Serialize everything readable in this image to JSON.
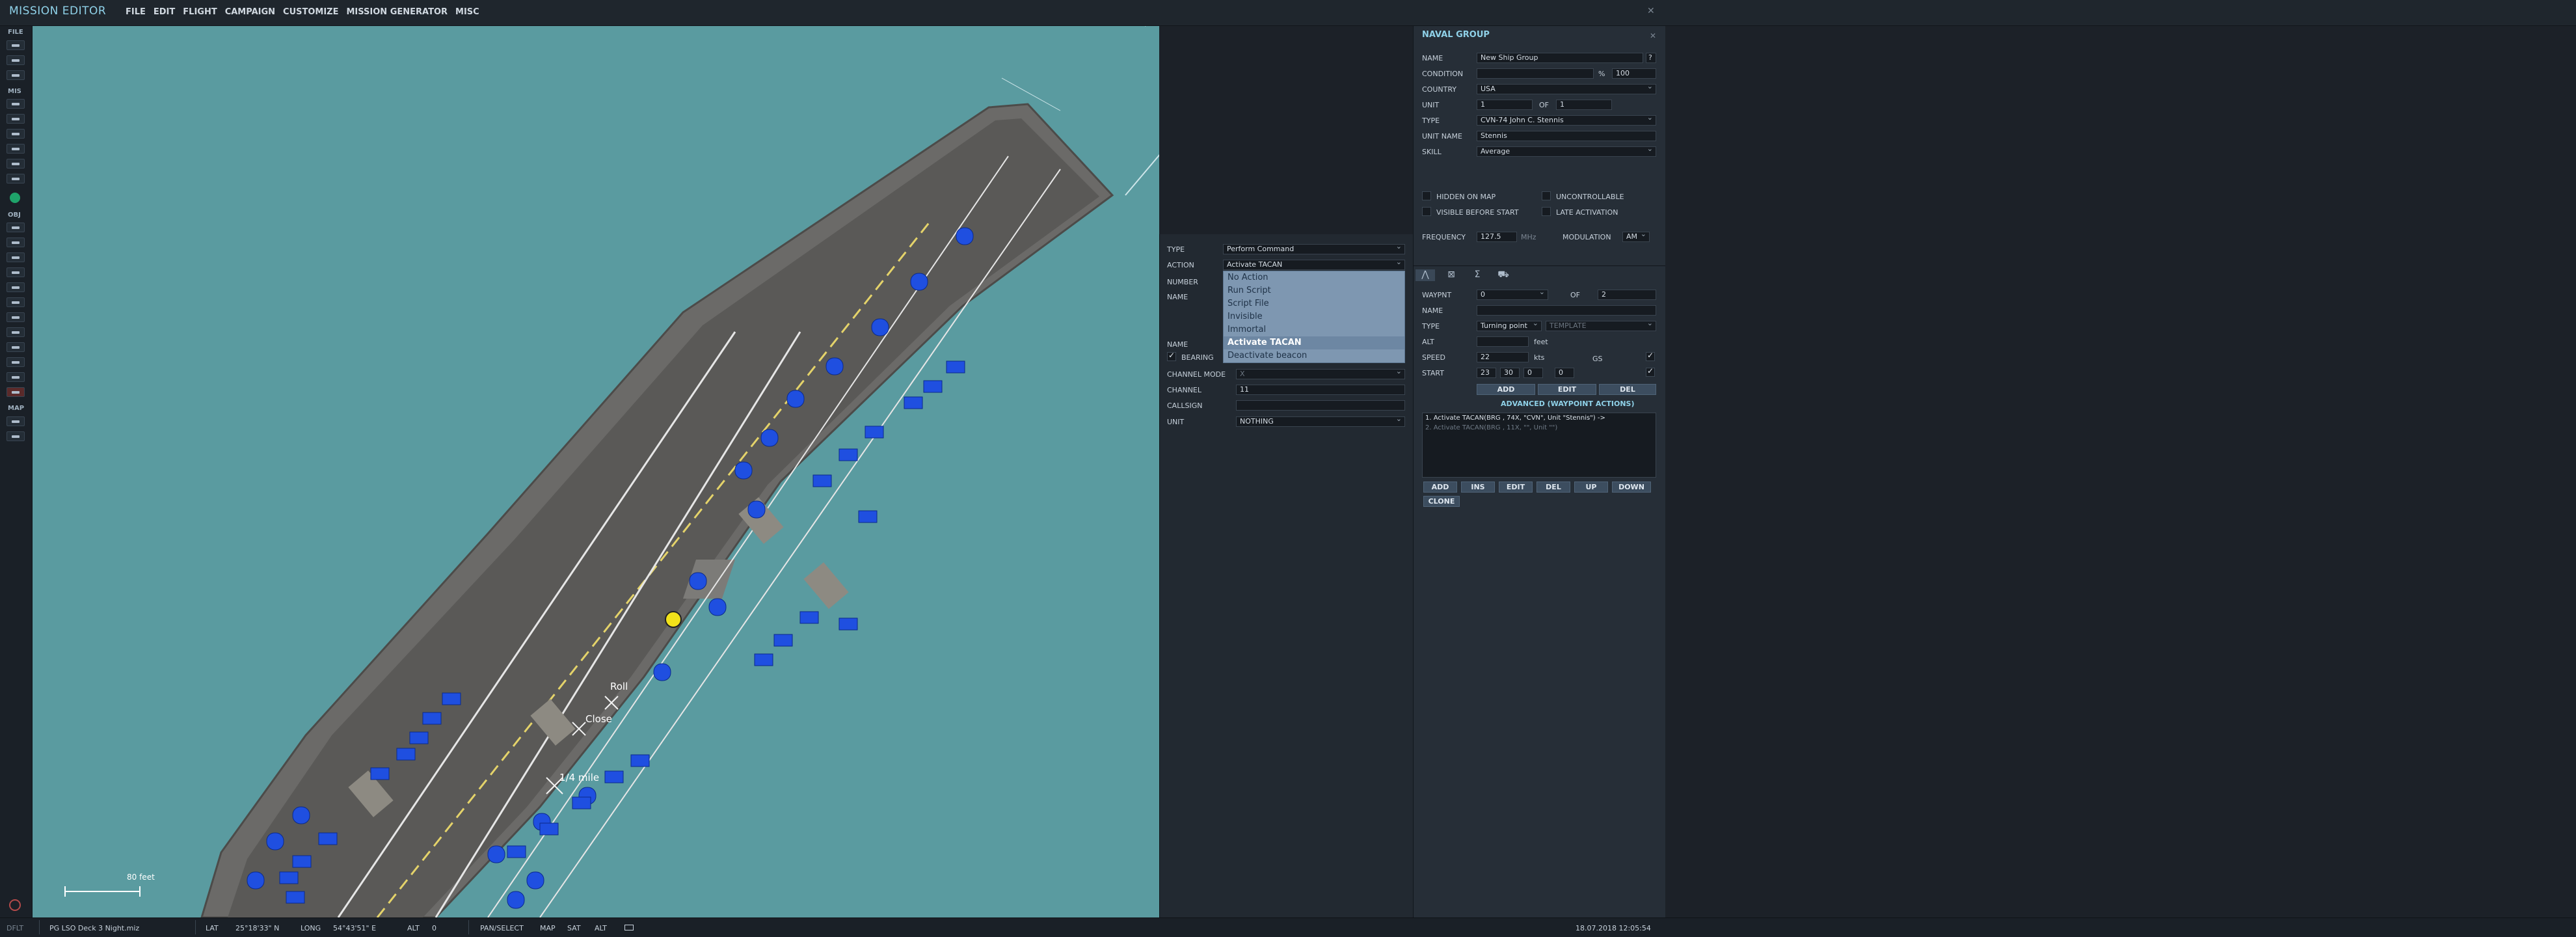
{
  "app": {
    "title": "MISSION EDITOR",
    "close": "✕"
  },
  "menu": [
    "FILE",
    "EDIT",
    "FLIGHT",
    "CAMPAIGN",
    "CUSTOMIZE",
    "MISSION GENERATOR",
    "MISC"
  ],
  "toolbar": {
    "file": "FILE",
    "mis": "MIS",
    "obj": "OBJ",
    "map": "MAP"
  },
  "map": {
    "labels": {
      "roll": "Roll",
      "close": "Close",
      "quarter_mile": "1/4 mile"
    },
    "scale": "80 feet"
  },
  "trigger": {
    "type_label": "TYPE",
    "type_value": "Perform Command",
    "action_label": "ACTION",
    "action_value": "Activate TACAN",
    "number_label": "NUMBER",
    "name_label": "NAME",
    "name2_label": "NAME",
    "bearing_label": "BEARING",
    "bearing_checked": true,
    "channel_mode_label": "CHANNEL MODE",
    "channel_mode_value": "X",
    "channel_label": "CHANNEL",
    "channel_value": "11",
    "callsign_label": "CALLSIGN",
    "callsign_value": "",
    "unit_label": "UNIT",
    "unit_value": "NOTHING",
    "action_options": [
      "No Action",
      "Run Script",
      "Script File",
      "Invisible",
      "Immortal",
      "Activate TACAN",
      "Deactivate beacon"
    ],
    "selected_option": "Activate TACAN"
  },
  "group": {
    "title": "NAVAL GROUP",
    "name_label": "NAME",
    "name_value": "New Ship Group",
    "help": "?",
    "condition_label": "CONDITION",
    "condition_unit": "%",
    "condition_value": "100",
    "country_label": "COUNTRY",
    "country_value": "USA",
    "unit_label": "UNIT",
    "unit_value": "1",
    "of_label": "OF",
    "of_value": "1",
    "type_label": "TYPE",
    "type_value": "CVN-74 John C. Stennis",
    "unit_name_label": "UNIT NAME",
    "unit_name_value": "Stennis",
    "skill_label": "SKILL",
    "skill_value": "Average",
    "hidden_on_map": "HIDDEN ON MAP",
    "uncontrollable": "UNCONTROLLABLE",
    "visible_before_start": "VISIBLE BEFORE START",
    "late_activation": "LATE ACTIVATION",
    "frequency_label": "FREQUENCY",
    "frequency_value": "127.5",
    "frequency_unit": "MHz",
    "modulation_label": "MODULATION",
    "modulation_value": "AM"
  },
  "waypoint": {
    "wpt_label": "WAYPNT",
    "wpt_value": "0",
    "of_label": "OF",
    "of_value": "2",
    "name_label": "NAME",
    "name_value": "",
    "type_label": "TYPE",
    "type_value": "Turning point",
    "template_value": "TEMPLATE",
    "alt_label": "ALT",
    "alt_unit": "feet",
    "speed_label": "SPEED",
    "speed_value": "22",
    "speed_unit": "kts",
    "gs_label": "GS",
    "start_label": "START",
    "start_h": "23",
    "start_m": "30",
    "start_s": "0",
    "start_d": "0",
    "add": "ADD",
    "edit": "EDIT",
    "del": "DEL",
    "advanced_title": "ADVANCED (WAYPOINT ACTIONS)",
    "actions": [
      "1. Activate TACAN(BRG , 74X, \"CVN\", Unit \"Stennis\")   ->",
      "2. Activate TACAN(BRG , 11X, \"\", Unit \"\")"
    ],
    "btn_add": "ADD",
    "btn_ins": "INS",
    "btn_edit": "EDIT",
    "btn_del": "DEL",
    "btn_up": "UP",
    "btn_down": "DOWN",
    "btn_clone": "CLONE"
  },
  "status": {
    "mode": "DFLT",
    "file": "PG LSO Deck 3 Night.miz",
    "lat_label": "LAT",
    "lat_value": "25°18'33\" N",
    "long_label": "LONG",
    "long_value": "54°43'51\" E",
    "alt_label": "ALT",
    "alt_value": "0",
    "pan": "PAN/SELECT",
    "map": "MAP",
    "sat": "SAT",
    "alt": "ALT",
    "datetime": "18.07.2018 12:05:54"
  }
}
